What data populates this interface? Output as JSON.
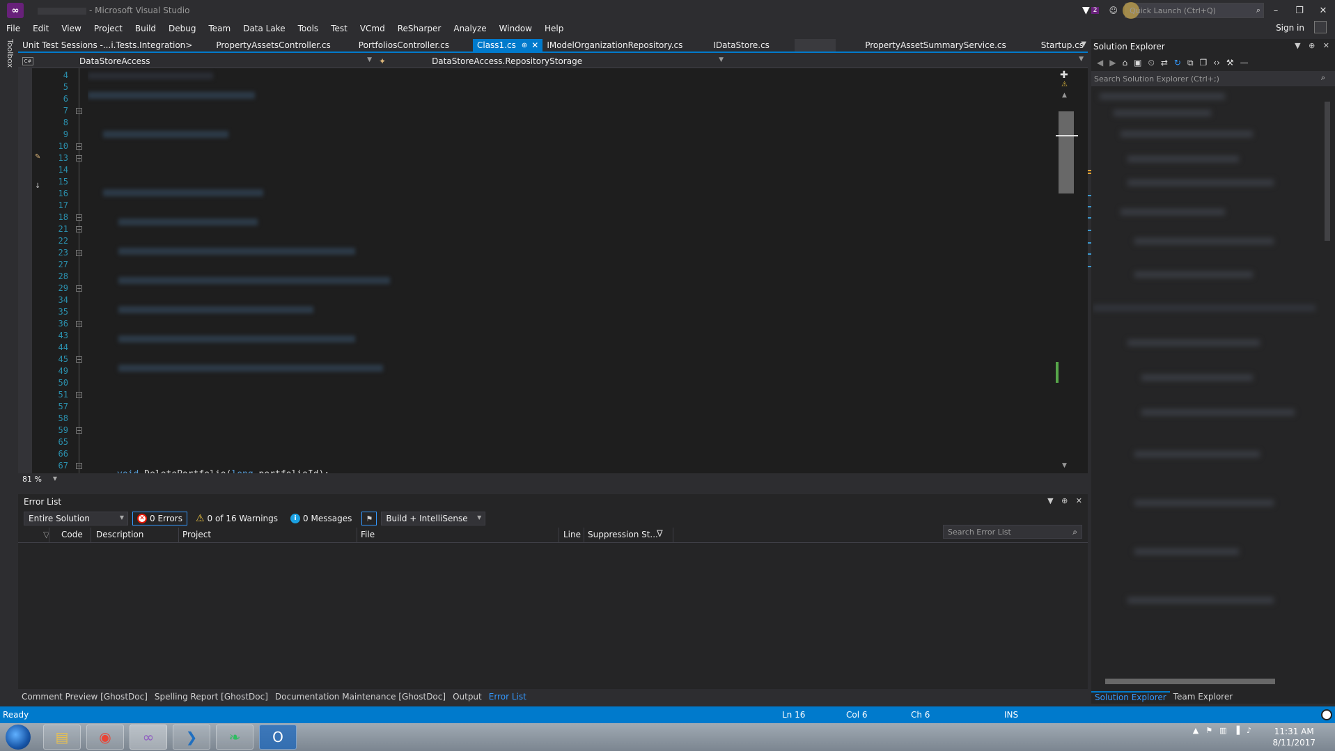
{
  "window": {
    "title_suffix": "- Microsoft Visual Studio",
    "notification_count": "2",
    "quick_launch_placeholder": "Quick Launch (Ctrl+Q)",
    "sign_in": "Sign in"
  },
  "menu": [
    "File",
    "Edit",
    "View",
    "Project",
    "Build",
    "Debug",
    "Team",
    "Data Lake",
    "Tools",
    "Test",
    "VCmd",
    "ReSharper",
    "Analyze",
    "Window",
    "Help"
  ],
  "toolbox_label": "Toolbox",
  "tabs": [
    {
      "label": "Unit Test Sessions -...i.Tests.Integration>"
    },
    {
      "label": "PropertyAssetsController.cs"
    },
    {
      "label": "PortfoliosController.cs"
    },
    {
      "label": "Class1.cs",
      "active": true
    },
    {
      "label": "IModelOrganizationRepository.cs"
    },
    {
      "label": "IDataStore.cs"
    },
    {
      "label": "",
      "blurred": true
    },
    {
      "label": "PropertyAssetSummaryService.cs"
    },
    {
      "label": "Startup.cs"
    }
  ],
  "navbar": {
    "project": "DataStoreAccess",
    "member": "DataStoreAccess.RepositoryStorage"
  },
  "editor": {
    "line_numbers": [
      "4",
      "5",
      "6",
      "7",
      "8",
      "9",
      "10",
      "13",
      "14",
      "15",
      "16",
      "17",
      "18",
      "21",
      "22",
      "23",
      "27",
      "28",
      "29",
      "34",
      "35",
      "36",
      "43",
      "44",
      "45",
      "49",
      "50",
      "51",
      "57",
      "58",
      "59",
      "65",
      "66",
      "67"
    ],
    "visible_code": "void DeletePortfolio(long portfolioId);",
    "zoom": "81 %"
  },
  "error_list": {
    "title": "Error List",
    "scope": "Entire Solution",
    "errors": "0 Errors",
    "warnings": "0 of 16 Warnings",
    "messages": "0 Messages",
    "source": "Build + IntelliSense",
    "search_placeholder": "Search Error List",
    "columns": [
      "Code",
      "Description",
      "Project",
      "File",
      "Line",
      "Suppression St..."
    ]
  },
  "bottom_tabs": [
    "Comment Preview [GhostDoc]",
    "Spelling Report [GhostDoc]",
    "Documentation Maintenance [GhostDoc]",
    "Output",
    "Error List"
  ],
  "solution_explorer": {
    "title": "Solution Explorer",
    "search_placeholder": "Search Solution Explorer (Ctrl+;)",
    "tabs": [
      "Solution Explorer",
      "Team Explorer"
    ]
  },
  "status": {
    "ready": "Ready",
    "line": "Ln 16",
    "col": "Col 6",
    "ch": "Ch 6",
    "mode": "INS"
  },
  "taskbar": {
    "time": "11:31 AM",
    "date": "8/11/2017"
  },
  "colors": {
    "accent": "#007acc",
    "background": "#2d2d30",
    "editor": "#1e1e1e"
  }
}
